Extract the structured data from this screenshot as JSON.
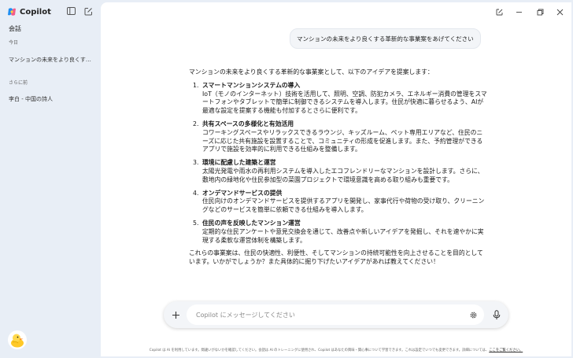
{
  "sidebar": {
    "brand": "Copilot",
    "heading": "会話",
    "sections": [
      {
        "label": "今日",
        "items": [
          "マンションの未来をより良くする革新的な事業案"
        ]
      },
      {
        "label": "さらに前",
        "items": [
          "李白 - 中国の詩人"
        ]
      }
    ]
  },
  "chat": {
    "user_message": "マンションの未来をより良くする革新的な事業案をあげてください",
    "intro": "マンションの未来をより良くする革新的な事業案として、以下のアイデアを提案します：",
    "items": [
      {
        "number": "1.",
        "title": "スマートマンションシステムの導入",
        "body": "IoT（モノのインターネット）技術を活用して、照明、空調、防犯カメラ、エネルギー消費の管理をスマートフォンやタブレットで簡単に制御できるシステムを導入します。住民が快適に暮らせるよう、AIが最適な設定を提案する機能も付加するとさらに便利です。"
      },
      {
        "number": "2.",
        "title": "共有スペースの多様化と有効活用",
        "body": "コワーキングスペースやリラックスできるラウンジ、キッズルーム、ペット専用エリアなど、住民のニーズに応じた共有施設を設置することで、コミュニティの形成を促進します。また、予約管理ができるアプリで施設を効率的に利用できる仕組みを整備します。"
      },
      {
        "number": "3.",
        "title": "環境に配慮した建築と運営",
        "body": "太陽光発電や雨水の再利用システムを導入したエコフレンドリーなマンションを設計します。さらに、敷地内の緑地化や住民参加型の菜園プロジェクトで環境意識を高める取り組みも重要です。"
      },
      {
        "number": "4.",
        "title": "オンデマンドサービスの提供",
        "body": "住民向けのオンデマンドサービスを提供するアプリを開発し、家事代行や荷物の受け取り、クリーニングなどのサービスを簡単に依頼できる仕組みを導入します。"
      },
      {
        "number": "5.",
        "title": "住民の声を反映したマンション運営",
        "body": "定期的な住民アンケートや意見交換会を通じて、改善点や新しいアイデアを発掘し、それを速やかに実現する柔軟な運営体制を構築します。"
      }
    ],
    "outro": "これらの事業案は、住民の快適性、利便性、そしてマンションの持続可能性を向上させることを目的としています。いかがでしょうか？また具体的に掘り下げたいアイデアがあれば教えてください！"
  },
  "composer": {
    "placeholder": "Copilot にメッセージしてください"
  },
  "footer": {
    "text": "Copilot は AI を利用しています。間違いがないかを確認してください。会話は AI のトレーニングに使用され、Copilot はあなたの興味・関心事について学習できます。これは設定でいつでも変更できます。詳細については、",
    "link": "ここをご覧ください。"
  },
  "colors": {
    "sidebar_bg": "#e8eef6",
    "main_bg": "#ffffff",
    "bubble_bg": "#f3f5f8"
  }
}
